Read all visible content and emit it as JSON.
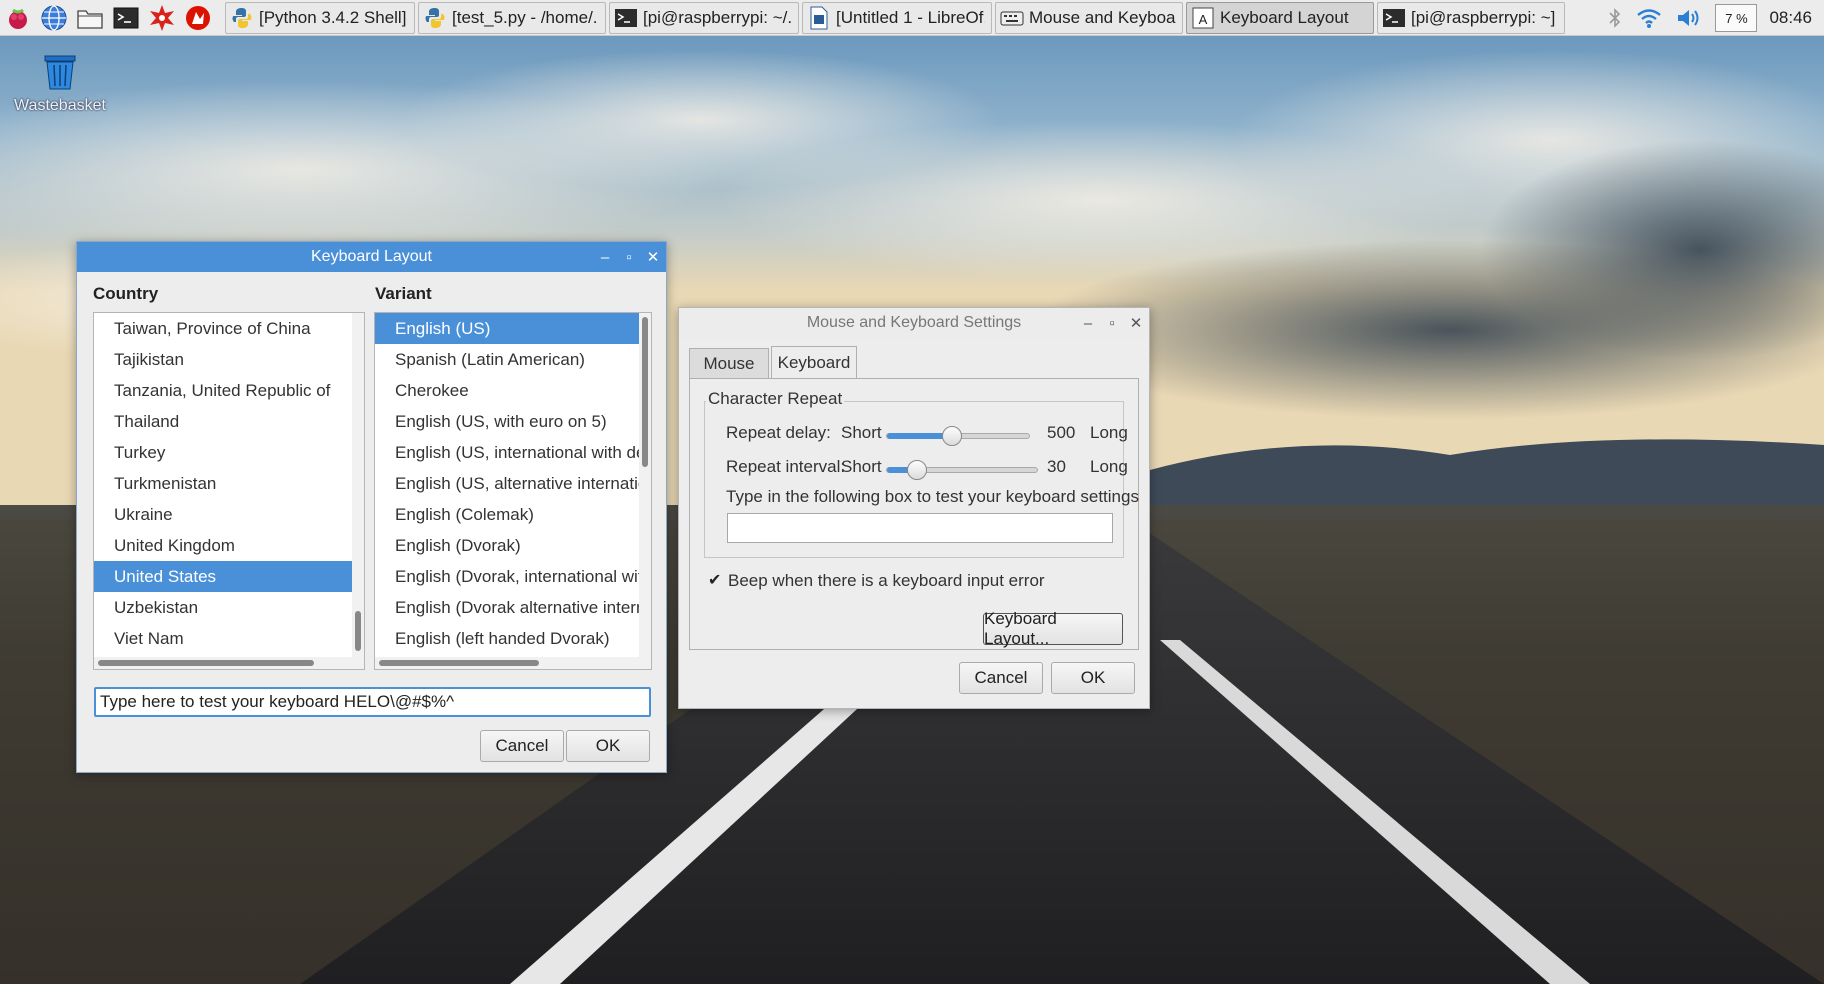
{
  "desktop": {
    "wastebasket_label": "Wastebasket"
  },
  "taskbar": {
    "launchers": [
      "raspberry-menu-icon",
      "web-browser-icon",
      "file-manager-icon",
      "terminal-icon",
      "mathematica-icon",
      "wolfram-icon"
    ],
    "tasks": [
      {
        "label": "[Python 3.4.2 Shell]",
        "icon": "python-icon"
      },
      {
        "label": "[test_5.py - /home/...",
        "icon": "python-icon"
      },
      {
        "label": "[pi@raspberrypi: ~/...",
        "icon": "terminal-icon"
      },
      {
        "label": "[Untitled 1 - LibreOf...",
        "icon": "libreoffice-writer-icon"
      },
      {
        "label": "Mouse and Keyboa...",
        "icon": "keyboard-icon"
      },
      {
        "label": "Keyboard Layout",
        "icon": "keyboard-layout-icon"
      },
      {
        "label": "[pi@raspberrypi: ~]",
        "icon": "terminal-icon"
      }
    ],
    "cpu_label": "7 %",
    "clock": "08:46"
  },
  "keyboard_layout": {
    "title": "Keyboard Layout",
    "country_header": "Country",
    "variant_header": "Variant",
    "countries": [
      "Taiwan, Province of China",
      "Tajikistan",
      "Tanzania, United Republic of",
      "Thailand",
      "Turkey",
      "Turkmenistan",
      "Ukraine",
      "United Kingdom",
      "United States",
      "Uzbekistan",
      "Viet Nam"
    ],
    "selected_country": "United States",
    "variants": [
      "English (US)",
      "Spanish (Latin American)",
      "Cherokee",
      "English (US, with euro on 5)",
      "English (US, international with dea",
      "English (US, alternative internation",
      "English (Colemak)",
      "English (Dvorak)",
      "English (Dvorak, international with",
      "English (Dvorak alternative interna",
      "English (left handed Dvorak)"
    ],
    "selected_variant": "English (US)",
    "test_value": "Type here to test your keyboard HELO\\@#$%^",
    "cancel_label": "Cancel",
    "ok_label": "OK"
  },
  "mouse_keyboard": {
    "title": "Mouse and Keyboard Settings",
    "tabs": [
      "Mouse",
      "Keyboard"
    ],
    "active_tab": "Keyboard",
    "char_repeat_legend": "Character Repeat",
    "repeat_delay": {
      "label": "Repeat delay:",
      "min_label": "Short",
      "max_label": "Long",
      "value": "500",
      "fraction": 0.45
    },
    "repeat_interval": {
      "label": "Repeat interval:",
      "min_label": "Short",
      "max_label": "Long",
      "value": "30",
      "fraction": 0.15
    },
    "test_prompt": "Type in the following box to test your keyboard settings",
    "test_value": "",
    "beep_label": "Beep when there is a keyboard input error",
    "beep_checked": true,
    "keyboard_layout_button": "Keyboard Layout...",
    "cancel_label": "Cancel",
    "ok_label": "OK"
  },
  "colors": {
    "accent": "#4a90d9",
    "window_bg": "#ededed",
    "taskbar_bg": "#ececec"
  }
}
